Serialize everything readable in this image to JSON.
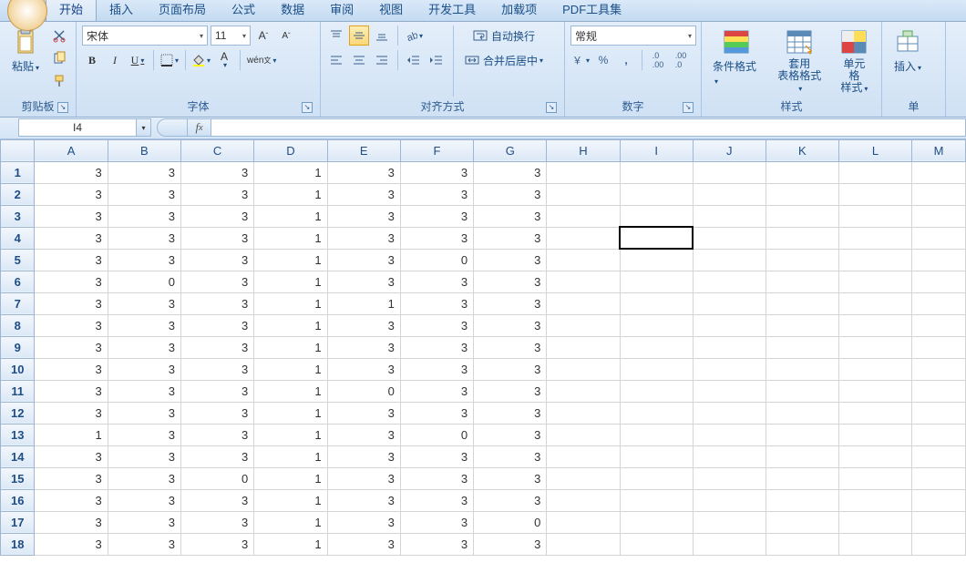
{
  "tabs": [
    "开始",
    "插入",
    "页面布局",
    "公式",
    "数据",
    "审阅",
    "视图",
    "开发工具",
    "加载项",
    "PDF工具集"
  ],
  "active_tab": "开始",
  "groups": {
    "clipboard": {
      "title": "剪贴板",
      "paste": "粘贴"
    },
    "font": {
      "title": "字体",
      "name": "宋体",
      "size": "11"
    },
    "align": {
      "title": "对齐方式",
      "wrap": "自动换行",
      "merge": "合并后居中"
    },
    "number": {
      "title": "数字",
      "format": "常规"
    },
    "styles": {
      "title": "样式",
      "cond": "条件格式",
      "table": "套用\n表格格式",
      "cell": "单元格\n样式"
    },
    "cells": {
      "title": "单",
      "insert": "插入"
    }
  },
  "namebox": "I4",
  "columns": [
    "A",
    "B",
    "C",
    "D",
    "E",
    "F",
    "G",
    "H",
    "I",
    "J",
    "K",
    "L",
    "M"
  ],
  "active_cell": {
    "row": 3,
    "col": 8
  },
  "data_rows": [
    [
      3,
      3,
      3,
      1,
      3,
      3,
      3
    ],
    [
      3,
      3,
      3,
      1,
      3,
      3,
      3
    ],
    [
      3,
      3,
      3,
      1,
      3,
      3,
      3
    ],
    [
      3,
      3,
      3,
      1,
      3,
      3,
      3
    ],
    [
      3,
      3,
      3,
      1,
      3,
      0,
      3
    ],
    [
      3,
      0,
      3,
      1,
      3,
      3,
      3
    ],
    [
      3,
      3,
      3,
      1,
      1,
      3,
      3
    ],
    [
      3,
      3,
      3,
      1,
      3,
      3,
      3
    ],
    [
      3,
      3,
      3,
      1,
      3,
      3,
      3
    ],
    [
      3,
      3,
      3,
      1,
      3,
      3,
      3
    ],
    [
      3,
      3,
      3,
      1,
      0,
      3,
      3
    ],
    [
      3,
      3,
      3,
      1,
      3,
      3,
      3
    ],
    [
      1,
      3,
      3,
      1,
      3,
      0,
      3
    ],
    [
      3,
      3,
      3,
      1,
      3,
      3,
      3
    ],
    [
      3,
      3,
      0,
      1,
      3,
      3,
      3
    ],
    [
      3,
      3,
      3,
      1,
      3,
      3,
      3
    ],
    [
      3,
      3,
      3,
      1,
      3,
      3,
      0
    ],
    [
      3,
      3,
      3,
      1,
      3,
      3,
      3
    ]
  ]
}
